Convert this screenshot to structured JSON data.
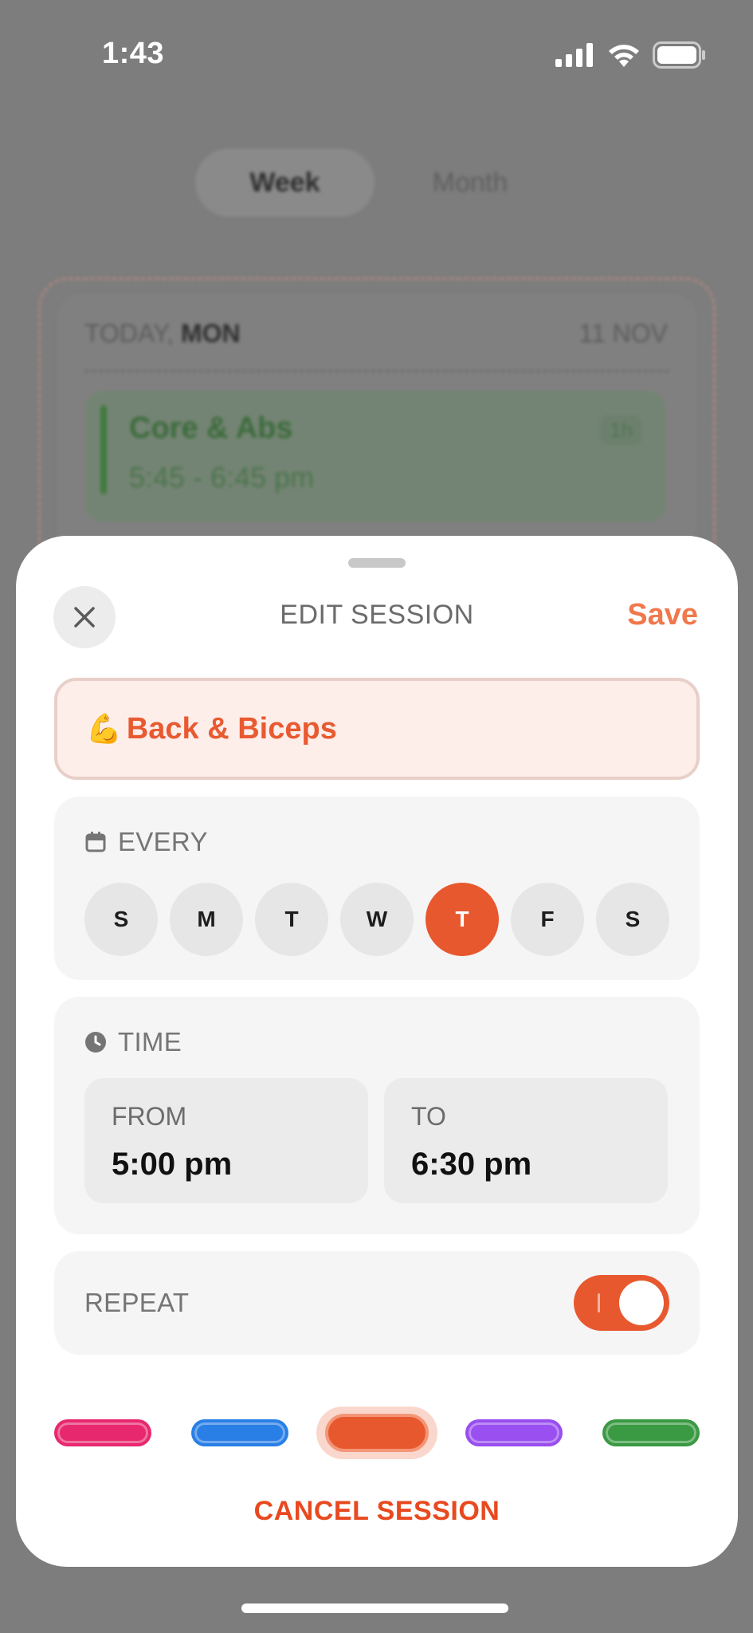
{
  "status_bar": {
    "time": "1:43"
  },
  "background": {
    "segmented": {
      "week": "Week",
      "month": "Month"
    },
    "day_card": {
      "label_prefix": "TODAY, ",
      "label_day": "MON",
      "date": "11 NOV",
      "event": {
        "title": "Core & Abs",
        "time": "5:45 - 6:45 pm",
        "duration": "1h"
      }
    }
  },
  "sheet": {
    "title": "EDIT SESSION",
    "save_label": "Save",
    "session_emoji": "💪",
    "session_name": "Back & Biceps",
    "every": {
      "label": "EVERY",
      "days": [
        "S",
        "M",
        "T",
        "W",
        "T",
        "F",
        "S"
      ],
      "selected_index": 4
    },
    "time": {
      "label": "TIME",
      "from_label": "FROM",
      "from_value": "5:00 pm",
      "to_label": "TO",
      "to_value": "6:30 pm"
    },
    "repeat": {
      "label": "REPEAT",
      "on": true
    },
    "colors": {
      "options": [
        "#e8286e",
        "#2a7fe6",
        "#e8582f",
        "#9a4ff0",
        "#3a9a43"
      ],
      "selected_index": 2
    },
    "cancel_label": "CANCEL SESSION"
  }
}
